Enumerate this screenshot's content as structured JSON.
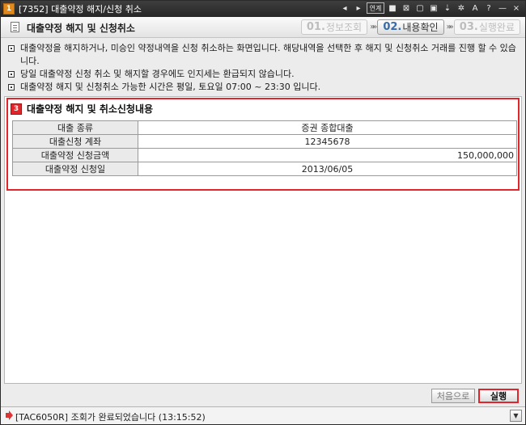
{
  "window": {
    "badge": "1",
    "title": "[7352] 대출약정 해지/신청 취소",
    "tools": [
      "◂",
      "▸",
      "연계",
      "■",
      "⊠",
      "▢",
      "▣",
      "⇣",
      "✲",
      "A",
      "?",
      "—",
      "×"
    ]
  },
  "header": {
    "title": "대출약정 해지 및 신청취소",
    "steps": [
      {
        "num": "01.",
        "label": "정보조회"
      },
      {
        "num": "02.",
        "label": "내용확인"
      },
      {
        "num": "03.",
        "label": "실행완료"
      }
    ],
    "arrow": "»»"
  },
  "notices": [
    "대출약정을 해지하거나, 미승인 약정내역을 신청 취소하는 화면입니다. 해당내역을 선택한 후 해지 및 신청취소 거래를 진행 할 수 있습니다.",
    "당일 대출약정 신청 취소 및 해지할 경우에도 인지세는 환급되지 않습니다.",
    "대출약정 해지 및 신청취소 가능한 시간은 평일, 토요일 07:00 ~ 23:30 입니다."
  ],
  "section": {
    "badge": "3",
    "title": "대출약정 해지 및 취소신청내용",
    "rows": [
      {
        "label": "대출 종류",
        "value": "증권 종합대출"
      },
      {
        "label": "대출신청 계좌",
        "value": "12345678"
      },
      {
        "label": "대출약정 신청금액",
        "value": "150,000,000"
      },
      {
        "label": "대출약정 신청일",
        "value": "2013/06/05"
      }
    ]
  },
  "buttons": {
    "reset": "처음으로",
    "run": "실행"
  },
  "status": {
    "text": "[TAC6050R] 조회가 완료되었습니다 (13:15:52)",
    "dropdown": "▼"
  },
  "colors": {
    "accent_red": "#e0262a",
    "badge_orange": "#e08a1e",
    "titlebar": "#2e2e2e"
  }
}
